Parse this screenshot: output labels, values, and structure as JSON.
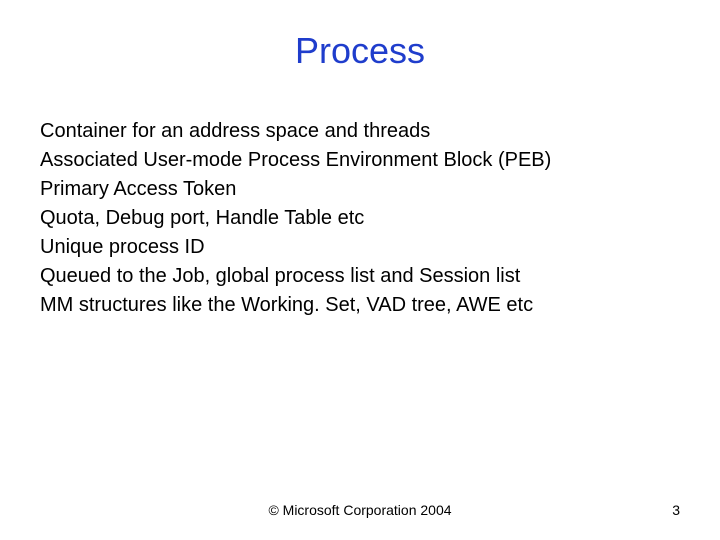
{
  "title": "Process",
  "bullets": [
    "Container for an address space and threads",
    "Associated User-mode Process Environment Block (PEB)",
    "Primary Access Token",
    "Quota, Debug port, Handle Table etc",
    "Unique process ID",
    "Queued to the Job, global process list and Session list",
    "MM structures like the Working. Set, VAD tree, AWE etc"
  ],
  "copyright": "© Microsoft Corporation 2004",
  "page_number": "3"
}
